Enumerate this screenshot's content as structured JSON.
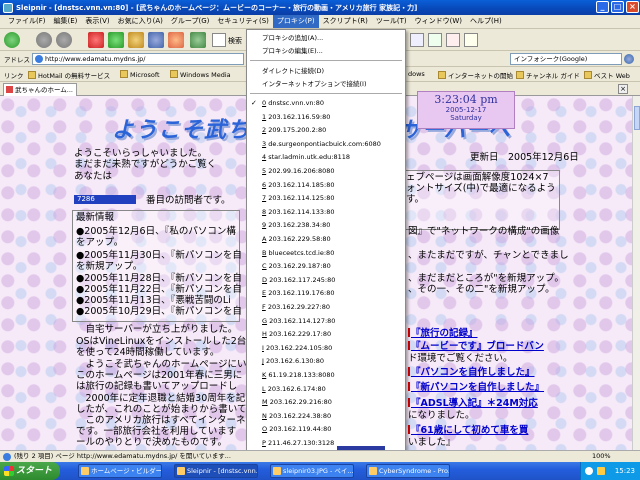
{
  "window": {
    "title": "Sleipnir - [dnstsc.vnn.vn:80] - [武ちゃんのホームページ：ムービーのコーナー・旅行の動画・アメリカ旅行 家族記・力]"
  },
  "menubar": [
    "ファイル(F)",
    "編集(E)",
    "表示(V)",
    "お気に入り(A)",
    "グループ(G)",
    "セキュリティ(S)",
    "プロキシ(P)",
    "スクリプト(R)",
    "ツール(T)",
    "ウィンドウ(W)",
    "ヘルプ(H)"
  ],
  "toolbar": {
    "search_label": "検索"
  },
  "addressbar": {
    "label": "アドレス",
    "url": "http://www.edamatu.mydns.jp/",
    "search_engine": "インフォシーク(Google)"
  },
  "linksbar": {
    "label": "リンク",
    "items": [
      "HotMail の無料サービス",
      "Microsoft",
      "Windows Media",
      "dows",
      "インターネットの開始",
      "チャンネル ガイド",
      "ベスト Web"
    ]
  },
  "tab": {
    "label": "武ちゃんのホーム..."
  },
  "proxy_menu": {
    "top_items": [
      "プロキシの追加(A)...",
      "プロキシの編集(E)..."
    ],
    "mid_items": [
      "ダイレクトに接続(D)",
      "インターネットオプションで接続(I)"
    ],
    "proxies": [
      {
        "num": "0",
        "host": "dnstsc.vnn.vn:80",
        "checked": true
      },
      {
        "num": "1",
        "host": "203.162.116.59:80",
        "checked": false
      },
      {
        "num": "2",
        "host": "209.175.200.2:80",
        "checked": false
      },
      {
        "num": "3",
        "host": "de.surgeonpontiacbuick.com:6080",
        "checked": false
      },
      {
        "num": "4",
        "host": "star.ladmin.utk.edu:8118",
        "checked": false
      },
      {
        "num": "5",
        "host": "202.99.16.206:8080",
        "checked": false
      },
      {
        "num": "6",
        "host": "203.162.114.185:80",
        "checked": false
      },
      {
        "num": "7",
        "host": "203.162.114.125:80",
        "checked": false
      },
      {
        "num": "8",
        "host": "203.162.114.133:80",
        "checked": false
      },
      {
        "num": "9",
        "host": "203.162.238.34:80",
        "checked": false
      },
      {
        "num": "A",
        "host": "203.162.229.58:80",
        "checked": false
      },
      {
        "num": "B",
        "host": "blueceetcs.tcd.ie:80",
        "checked": false
      },
      {
        "num": "C",
        "host": "203.162.29.187:80",
        "checked": false
      },
      {
        "num": "D",
        "host": "203.162.117.245:80",
        "checked": false
      },
      {
        "num": "E",
        "host": "203.162.119.176:80",
        "checked": false
      },
      {
        "num": "F",
        "host": "203.162.29.227:80",
        "checked": false
      },
      {
        "num": "G",
        "host": "203.162.114.127:80",
        "checked": false
      },
      {
        "num": "H",
        "host": "203.162.229.17:80",
        "checked": false
      },
      {
        "num": "I",
        "host": "203.162.224.105:80",
        "checked": false
      },
      {
        "num": "J",
        "host": "203.162.6.130:80",
        "checked": false
      },
      {
        "num": "K",
        "host": "61.19.218.133:8080",
        "checked": false
      },
      {
        "num": "L",
        "host": "203.162.6.174:80",
        "checked": false
      },
      {
        "num": "M",
        "host": "203.162.29.216:80",
        "checked": false
      },
      {
        "num": "N",
        "host": "203.162.224.38:80",
        "checked": false
      },
      {
        "num": "O",
        "host": "203.162.119.44:80",
        "checked": false
      },
      {
        "num": "P",
        "host": "211.46.27.130:3128",
        "checked": false
      }
    ]
  },
  "page": {
    "clock_time": "3:23:04 pm",
    "clock_date": "2005-12-17",
    "clock_day": "Saturday",
    "banner_left": "ようこそ武ちゃ",
    "banner_right": "サーバーへ",
    "welcome_1": "ようこそいらっしゃいました。",
    "welcome_2": "まだまだ未熟ですがどうかご覧く",
    "you_are": "あなたは",
    "counter_value": "7286",
    "visitor_suffix": "番目の訪問者です。",
    "updated": "更新日　2005年12月6日",
    "right_note_1": "ェブページは画面解像度1024×7",
    "right_note_2": "ォントサイズ(中)で最適になるよう",
    "right_note_3": "す。",
    "news_title": "最新情報",
    "news": [
      "●2005年12月6日、『私のパソコン構",
      "をアップ。",
      "●2005年11月30日、『新パソコンを自",
      "を新規アップ。",
      "●2005年11月28日、『新パソコンを自",
      "●2005年11月22日、『新パソコンを自",
      "●2005年11月13日、『悪戦苦闘のLi",
      "●2005年10月29日、『新パソコンを自"
    ],
    "news_right": [
      "図』で\"ネットワークの構成\"の画像",
      "、またまだですが、チャンとできまし",
      "、まだまだところが\"を新規アップ。",
      "、その一、その二\"を新規アップ。"
    ],
    "body": [
      "　自宅サーバーが立ち上がりました。",
      "OSはVineLinuxをインストールした2台の",
      "を使って24時間稼働しています。",
      "　ようこそ武ちゃんのホームページにい",
      "このホームページは2001年春に三男に",
      "は旅行の記録も書いてアップロードし",
      "　2000年に定年退職と結婚30周年を記",
      "したが、これのことが始まりから書いてみ",
      "　このアメリカ旅行はすべてインターネット",
      "です。一部旅行会社を利用しています",
      "ールのやりとりで決めたものです。"
    ],
    "links": [
      "『旅行の記録』",
      "『ムービーです』ブロードバン",
      "ド環境でご覧ください。",
      "『パソコンを自作しました』",
      "『新パソコンを自作しました』",
      "『ADSL導入記』＊24M対応",
      "になりました。",
      "『61歳にして初めて車を買",
      "いました』"
    ]
  },
  "statusbar": {
    "text": "(残り 2 項目) ページ http://www.edamatu.mydns.jp/ を開いています...",
    "zoom": "100%"
  },
  "taskbar": {
    "start": "スタート",
    "tasks": [
      "ホームページ・ビルダー -",
      "Sleipnir - [dnstsc.vnn...",
      "sleipnir03.JPG - ペイ...",
      "CyberSyndrome - Pro..."
    ],
    "clock": "15:23"
  }
}
